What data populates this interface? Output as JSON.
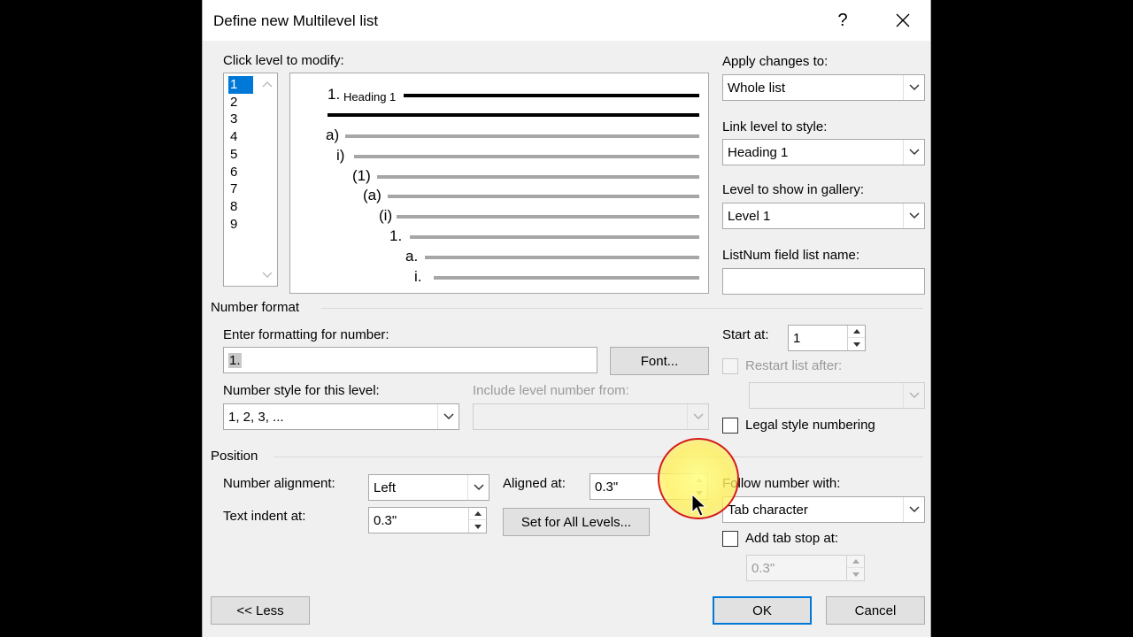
{
  "dialog": {
    "title": "Define new Multilevel list",
    "help": "?",
    "close": "✕"
  },
  "levels": {
    "label": "Click level to modify:",
    "items": [
      "1",
      "2",
      "3",
      "4",
      "5",
      "6",
      "7",
      "8",
      "9"
    ],
    "selected": "1"
  },
  "preview": {
    "rows": [
      {
        "num": "1.",
        "text": "Heading 1"
      },
      {
        "num": "a)"
      },
      {
        "num": "i)"
      },
      {
        "num": "(1)"
      },
      {
        "num": "(a)"
      },
      {
        "num": "(i)"
      },
      {
        "num": "1."
      },
      {
        "num": "a."
      },
      {
        "num": "i."
      }
    ]
  },
  "right": {
    "apply_label": "Apply changes to:",
    "apply_value": "Whole list",
    "link_label": "Link level to style:",
    "link_value": "Heading 1",
    "gallery_label": "Level to show in gallery:",
    "gallery_value": "Level 1",
    "listnum_label": "ListNum field list name:",
    "listnum_value": ""
  },
  "number_format": {
    "section": "Number format",
    "enter_label": "Enter formatting for number:",
    "enter_value": "1.",
    "font_button": "Font...",
    "style_label": "Number style for this level:",
    "style_value": "1, 2, 3, ...",
    "include_label": "Include level number from:",
    "include_value": "",
    "start_label": "Start at:",
    "start_value": "1",
    "restart_label": "Restart list after:",
    "restart_value": "",
    "legal_label": "Legal style numbering"
  },
  "position": {
    "section": "Position",
    "align_label": "Number alignment:",
    "align_value": "Left",
    "aligned_at_label": "Aligned at:",
    "aligned_at_value": "0.3\"",
    "indent_label": "Text indent at:",
    "indent_value": "0.3\"",
    "set_all_button": "Set for All Levels...",
    "follow_label": "Follow number with:",
    "follow_value": "Tab character",
    "tabstop_label": "Add tab stop at:",
    "tabstop_value": "0.3\""
  },
  "footer": {
    "less_button": "<< Less",
    "ok_button": "OK",
    "cancel_button": "Cancel"
  },
  "colors": {
    "selection": "#0078d7",
    "dialog_bg": "#f0f0f0",
    "cursor_highlight": "#ffef5a",
    "highlight_ring": "#d51a1a"
  }
}
